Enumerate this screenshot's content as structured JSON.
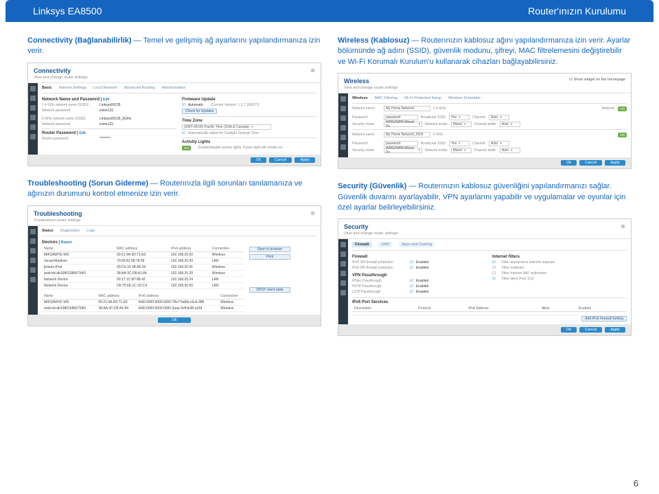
{
  "header": {
    "left": "Linksys EA8500",
    "right": "Router'ınızın Kurulumu"
  },
  "page_num": "6",
  "connectivity": {
    "desc_bold": "Connectivity (Bağlanabilirlik)",
    "desc_rest": " — Temel ve gelişmiş ağ ayarlarını yapılandırmanıza izin verir.",
    "panel": {
      "title": "Connectivity",
      "sub": "View and change router settings",
      "tabs": [
        "Basic",
        "Internet Settings",
        "Local Network",
        "Advanced Routing",
        "Administration"
      ],
      "section_network": "Network Name and Password",
      "edit": "Edit",
      "n24_label": "2.4 GHz network name (SSID):",
      "n24_val": "Linksys00135",
      "n24p_label": "Network password:",
      "n24p_val": "irvine131",
      "n5_label": "5 GHz network name (SSID):",
      "n5_val": "Linksys00135_5GHz",
      "n5p_label": "Network password:",
      "n5p_val": "irvine131",
      "router_pw_title": "Router Password",
      "router_pw_label": "Router password:",
      "router_pw_val": "********",
      "firmware_title": "Firmware Update",
      "automatic": "Automatic",
      "version": "(Current Version: 1.1.7.166227)",
      "check_updates": "Check for Updates",
      "tz_title": "Time Zone",
      "tz_val": "(GMT-08:00) Pacific Time (USA & Canada)",
      "tz_auto": "Automatically adjust for Daylight Savings Time",
      "activity_title": "Activity Lights",
      "activity_on": "ON",
      "activity_note": "Enable/disable activity lights. Power light will remain on.",
      "ok": "Ok",
      "cancel": "Cancel",
      "apply": "Apply"
    }
  },
  "wireless": {
    "desc_bold": "Wireless (Kablosuz)",
    "desc_rest": " — Routerınızın kablosuz ağını yapılandırmanıza izin verir. Ayarlar bölümünde ağ adını (SSID), güvenlik modunu, şifreyi, MAC filtrelemesini değiştirebilir ve Wi-Fi Korumalı Kurulum'u kullanarak cihazları bağlayabilirsiniz.",
    "panel": {
      "title": "Wireless",
      "sub": "View and change router settings",
      "widget": "Show widget on the homepage",
      "tabs": [
        "Wireless",
        "MAC Filtering",
        "Wi-Fi Protected Setup",
        "Wireless Scheduler"
      ],
      "band24": {
        "name_label": "Network name:",
        "name_val": "My Home Network",
        "band": "2.4 GHz",
        "network": "Network:",
        "on": "ON",
        "pw_label": "Password:",
        "pw_val": "password",
        "bssid_label": "Broadcast SSID:",
        "bssid_val": "Yes",
        "ch_label": "Channel:",
        "ch_val": "Auto",
        "sec_label": "Security mode:",
        "sec_val": "WPA2/WPA Mixed Pe",
        "nm_label": "Network mode:",
        "nm_val": "Mixed",
        "cw_label": "Channel width:",
        "cw_val": "Auto"
      },
      "band5": {
        "name_label": "Network name:",
        "name_val": "My Home Network_5GH",
        "band": "5 GHz",
        "on": "ON",
        "pw_label": "Password:",
        "pw_val": "password",
        "bssid_label": "Broadcast SSID:",
        "bssid_val": "Yes",
        "ch_label": "Channel:",
        "ch_val": "Auto",
        "sec_label": "Security mode:",
        "sec_val": "WPA2/WPA Mixed Pe",
        "nm_label": "Network mode:",
        "nm_val": "Mixed",
        "cw_label": "Channel width:",
        "cw_val": "Auto"
      },
      "ok": "Ok",
      "cancel": "Cancel",
      "apply": "Apply"
    }
  },
  "troubleshooting": {
    "desc_bold": "Troubleshooting (Sorun Giderme)",
    "desc_rest": " — Routerınızla ilgili sorunları tanılamanıza ve ağınızın durumunu kontrol etmenize izin verir.",
    "panel": {
      "title": "Troubleshooting",
      "sub": "Troubleshoot router settings",
      "tabs": [
        "Status",
        "Diagnostics",
        "Logs"
      ],
      "devices": "Devices",
      "report": "Report",
      "open_browser": "Open in browser",
      "print": "Print",
      "dhcp": "DHCP client table",
      "t1": {
        "h": [
          "Name",
          "MAC address",
          "IPv4 address",
          "Connection"
        ],
        "r": [
          [
            "MIKSAWYE-WS",
            "00:21:9A:9D:71:E0",
            "192.168.20.50",
            "Wireless"
          ],
          [
            "Jeraul-Madison",
            "70:56:81:98:78:09",
            "192.168.20.43",
            "LAN"
          ],
          [
            "jerauls-iPod",
            "00:C6:10:1B:A6:34",
            "192.168.20.41",
            "Wireless"
          ],
          [
            "android-db198619866754f1",
            "38:AA:3C:D8:A1:84",
            "192.168.20.20",
            "Wireless"
          ],
          [
            "Network Device",
            "00:27:1C:B7:88:42",
            "192.168.20.24",
            "LAN"
          ],
          [
            "Network Device",
            "D6:75:0E:1C:1D:C4",
            "192.168.20.50",
            "LAN"
          ]
        ]
      },
      "t2": {
        "h": [
          "Name",
          "MAC address",
          "IPv6 address",
          "Connection"
        ],
        "r": [
          [
            "MIKSAWYE-WS",
            "00:21:9A:9D:71:E0",
            "fe80:0000:0000:0000:78e7:f\\a6fa:c5cb:388",
            "Wireless"
          ],
          [
            "android-db198619866754f1",
            "38:AA:3C:D8:A1:84",
            "fe80:0000:0000:0000:3aaa:3cff:fe38:a184",
            "Wireless"
          ]
        ]
      },
      "ok": "Ok"
    }
  },
  "security": {
    "desc_bold": "Security (Güvenlik)",
    "desc_rest": " — Routerınızın kablosuz güvenliğini yapılandırmanızı sağlar. Güvenlik duvarını ayarlayabilir, VPN ayarlarını yapabilir ve uygulamalar ve oyunlar için özel ayarlar belirleyebilirsiniz.",
    "panel": {
      "title": "Security",
      "sub": "View and change router settings",
      "tabs": [
        "Firewall",
        "DMZ",
        "Apps and Gaming"
      ],
      "fw_title": "Firewall",
      "fw_items": [
        [
          "IPv4 SPI firewall protection",
          "Enabled"
        ],
        [
          "IPv6 SPI firewall protection",
          "Enabled"
        ]
      ],
      "vpn_title": "VPN Passthrough",
      "vpn_items": [
        [
          "IPSec Passthrough",
          "Enabled"
        ],
        [
          "PPTP Passthrough",
          "Enabled"
        ],
        [
          "L2TP Passthrough",
          "Enabled"
        ]
      ],
      "if_title": "Internet filters",
      "if_items": [
        "Filter anonymous Internet requests",
        "Filter multicast",
        "Filter Internet NAT redirection",
        "Filter ident (Port 113)"
      ],
      "ipv6_title": "IPv6 Port Services",
      "ipv6_headers": [
        "Description",
        "Protocol",
        "IPv6 Address",
        "Allow",
        "Enabled"
      ],
      "add_setting": "Add IPv6 Firewall Setting",
      "ok": "Ok",
      "cancel": "Cancel",
      "apply": "Apply"
    }
  }
}
